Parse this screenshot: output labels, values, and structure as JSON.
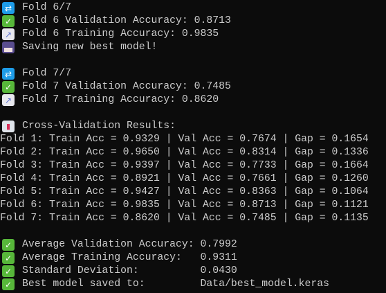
{
  "fold6": {
    "header": "Fold 6/7",
    "val": "Fold 6 Validation Accuracy: 0.8713",
    "train": "Fold 6 Training Accuracy: 0.9835",
    "save": "Saving new best model!"
  },
  "fold7": {
    "header": "Fold 7/7",
    "val": "Fold 7 Validation Accuracy: 0.7485",
    "train": "Fold 7 Training Accuracy: 0.8620"
  },
  "results": {
    "title": "Cross-Validation Results:",
    "rows": [
      "Fold 1: Train Acc = 0.9329 | Val Acc = 0.7674 | Gap = 0.1654",
      "Fold 2: Train Acc = 0.9650 | Val Acc = 0.8314 | Gap = 0.1336",
      "Fold 3: Train Acc = 0.9397 | Val Acc = 0.7733 | Gap = 0.1664",
      "Fold 4: Train Acc = 0.8921 | Val Acc = 0.7661 | Gap = 0.1260",
      "Fold 5: Train Acc = 0.9427 | Val Acc = 0.8363 | Gap = 0.1064",
      "Fold 6: Train Acc = 0.9835 | Val Acc = 0.8713 | Gap = 0.1121",
      "Fold 7: Train Acc = 0.8620 | Val Acc = 0.7485 | Gap = 0.1135"
    ]
  },
  "summary": [
    "Average Validation Accuracy: 0.7992",
    "Average Training Accuracy:   0.9311",
    "Standard Deviation:          0.0430",
    "Best model saved to:         Data/best_model.keras"
  ],
  "icons": {
    "repeat": "repeat-icon",
    "check": "check-mark-icon",
    "chart": "chart-increasing-icon",
    "save": "floppy-disk-icon",
    "bar": "bar-chart-icon"
  }
}
